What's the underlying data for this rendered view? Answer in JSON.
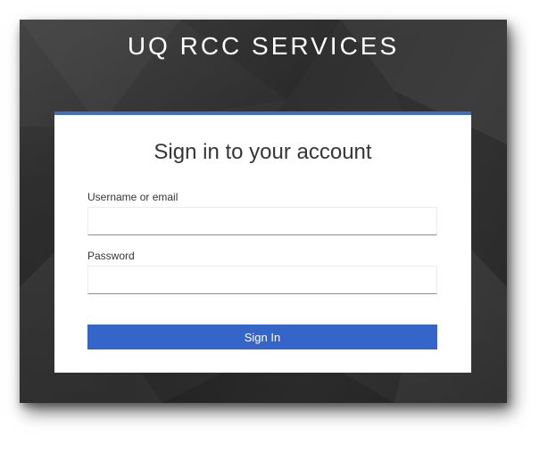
{
  "header": {
    "title": "UQ RCC SERVICES"
  },
  "login": {
    "title": "Sign in to your account",
    "username_label": "Username or email",
    "username_value": "",
    "password_label": "Password",
    "password_value": "",
    "submit_label": "Sign In"
  },
  "colors": {
    "accent": "#3565c8",
    "card_top_border": "#3f6cc4",
    "background": "#333333",
    "text": "#363636"
  }
}
